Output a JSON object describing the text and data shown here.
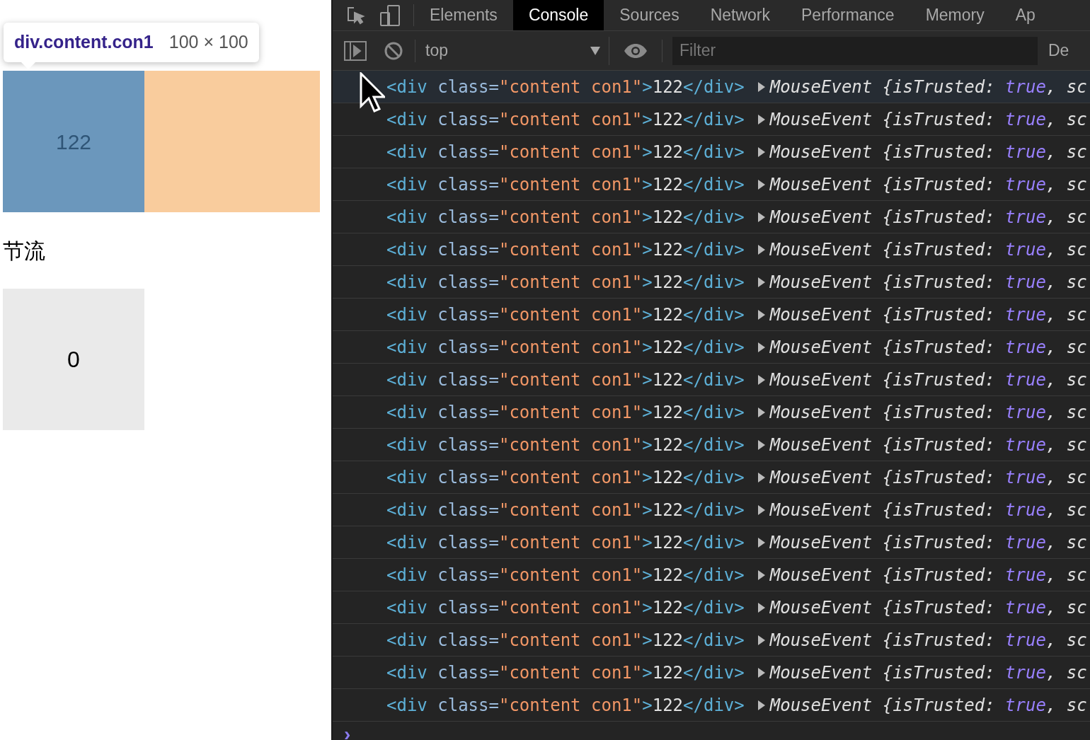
{
  "page": {
    "tooltip": {
      "selector": "div.content.con1",
      "size": "100 × 100"
    },
    "boxes": [
      {
        "text": "122",
        "highlighted": true
      }
    ],
    "heading": "节流",
    "counter": {
      "text": "0"
    }
  },
  "devtools": {
    "tabs": [
      {
        "label": "Elements",
        "selected": false
      },
      {
        "label": "Console",
        "selected": true
      },
      {
        "label": "Sources",
        "selected": false
      },
      {
        "label": "Network",
        "selected": false
      },
      {
        "label": "Performance",
        "selected": false
      },
      {
        "label": "Memory",
        "selected": false
      },
      {
        "label": "Ap",
        "selected": false
      }
    ],
    "context": "top",
    "filter": {
      "placeholder": "Filter"
    },
    "levels": "De",
    "rows": [
      {
        "hovered": true,
        "expanded": false,
        "element": [
          "<div",
          " class=",
          "\"content con1\"",
          ">",
          "122",
          "</div>"
        ],
        "object": [
          "MouseEvent {isTrusted: ",
          "true",
          ", sc"
        ]
      },
      {
        "hovered": false,
        "expanded": false,
        "element": [
          "<div",
          " class=",
          "\"content con1\"",
          ">",
          "122",
          "</div>"
        ],
        "object": [
          "MouseEvent {isTrusted: ",
          "true",
          ", sc"
        ]
      },
      {
        "hovered": false,
        "expanded": false,
        "element": [
          "<div",
          " class=",
          "\"content con1\"",
          ">",
          "122",
          "</div>"
        ],
        "object": [
          "MouseEvent {isTrusted: ",
          "true",
          ", sc"
        ]
      },
      {
        "hovered": false,
        "expanded": false,
        "element": [
          "<div",
          " class=",
          "\"content con1\"",
          ">",
          "122",
          "</div>"
        ],
        "object": [
          "MouseEvent {isTrusted: ",
          "true",
          ", sc"
        ]
      },
      {
        "hovered": false,
        "expanded": false,
        "element": [
          "<div",
          " class=",
          "\"content con1\"",
          ">",
          "122",
          "</div>"
        ],
        "object": [
          "MouseEvent {isTrusted: ",
          "true",
          ", sc"
        ]
      },
      {
        "hovered": false,
        "expanded": false,
        "element": [
          "<div",
          " class=",
          "\"content con1\"",
          ">",
          "122",
          "</div>"
        ],
        "object": [
          "MouseEvent {isTrusted: ",
          "true",
          ", sc"
        ]
      },
      {
        "hovered": false,
        "expanded": false,
        "element": [
          "<div",
          " class=",
          "\"content con1\"",
          ">",
          "122",
          "</div>"
        ],
        "object": [
          "MouseEvent {isTrusted: ",
          "true",
          ", sc"
        ]
      },
      {
        "hovered": false,
        "expanded": false,
        "element": [
          "<div",
          " class=",
          "\"content con1\"",
          ">",
          "122",
          "</div>"
        ],
        "object": [
          "MouseEvent {isTrusted: ",
          "true",
          ", sc"
        ]
      },
      {
        "hovered": false,
        "expanded": false,
        "element": [
          "<div",
          " class=",
          "\"content con1\"",
          ">",
          "122",
          "</div>"
        ],
        "object": [
          "MouseEvent {isTrusted: ",
          "true",
          ", sc"
        ]
      },
      {
        "hovered": false,
        "expanded": false,
        "element": [
          "<div",
          " class=",
          "\"content con1\"",
          ">",
          "122",
          "</div>"
        ],
        "object": [
          "MouseEvent {isTrusted: ",
          "true",
          ", sc"
        ]
      },
      {
        "hovered": false,
        "expanded": false,
        "element": [
          "<div",
          " class=",
          "\"content con1\"",
          ">",
          "122",
          "</div>"
        ],
        "object": [
          "MouseEvent {isTrusted: ",
          "true",
          ", sc"
        ]
      },
      {
        "hovered": false,
        "expanded": false,
        "element": [
          "<div",
          " class=",
          "\"content con1\"",
          ">",
          "122",
          "</div>"
        ],
        "object": [
          "MouseEvent {isTrusted: ",
          "true",
          ", sc"
        ]
      },
      {
        "hovered": false,
        "expanded": false,
        "element": [
          "<div",
          " class=",
          "\"content con1\"",
          ">",
          "122",
          "</div>"
        ],
        "object": [
          "MouseEvent {isTrusted: ",
          "true",
          ", sc"
        ]
      },
      {
        "hovered": false,
        "expanded": false,
        "element": [
          "<div",
          " class=",
          "\"content con1\"",
          ">",
          "122",
          "</div>"
        ],
        "object": [
          "MouseEvent {isTrusted: ",
          "true",
          ", sc"
        ]
      },
      {
        "hovered": false,
        "expanded": false,
        "element": [
          "<div",
          " class=",
          "\"content con1\"",
          ">",
          "122",
          "</div>"
        ],
        "object": [
          "MouseEvent {isTrusted: ",
          "true",
          ", sc"
        ]
      },
      {
        "hovered": false,
        "expanded": false,
        "element": [
          "<div",
          " class=",
          "\"content con1\"",
          ">",
          "122",
          "</div>"
        ],
        "object": [
          "MouseEvent {isTrusted: ",
          "true",
          ", sc"
        ]
      },
      {
        "hovered": false,
        "expanded": false,
        "element": [
          "<div",
          " class=",
          "\"content con1\"",
          ">",
          "122",
          "</div>"
        ],
        "object": [
          "MouseEvent {isTrusted: ",
          "true",
          ", sc"
        ]
      },
      {
        "hovered": false,
        "expanded": false,
        "element": [
          "<div",
          " class=",
          "\"content con1\"",
          ">",
          "122",
          "</div>"
        ],
        "object": [
          "MouseEvent {isTrusted: ",
          "true",
          ", sc"
        ]
      },
      {
        "hovered": false,
        "expanded": false,
        "element": [
          "<div",
          " class=",
          "\"content con1\"",
          ">",
          "122",
          "</div>"
        ],
        "object": [
          "MouseEvent {isTrusted: ",
          "true",
          ", sc"
        ]
      },
      {
        "hovered": false,
        "expanded": false,
        "element": [
          "<div",
          " class=",
          "\"content con1\"",
          ">",
          "122",
          "</div>"
        ],
        "object": [
          "MouseEvent {isTrusted: ",
          "true",
          ", sc"
        ]
      }
    ],
    "prompt": "›"
  }
}
